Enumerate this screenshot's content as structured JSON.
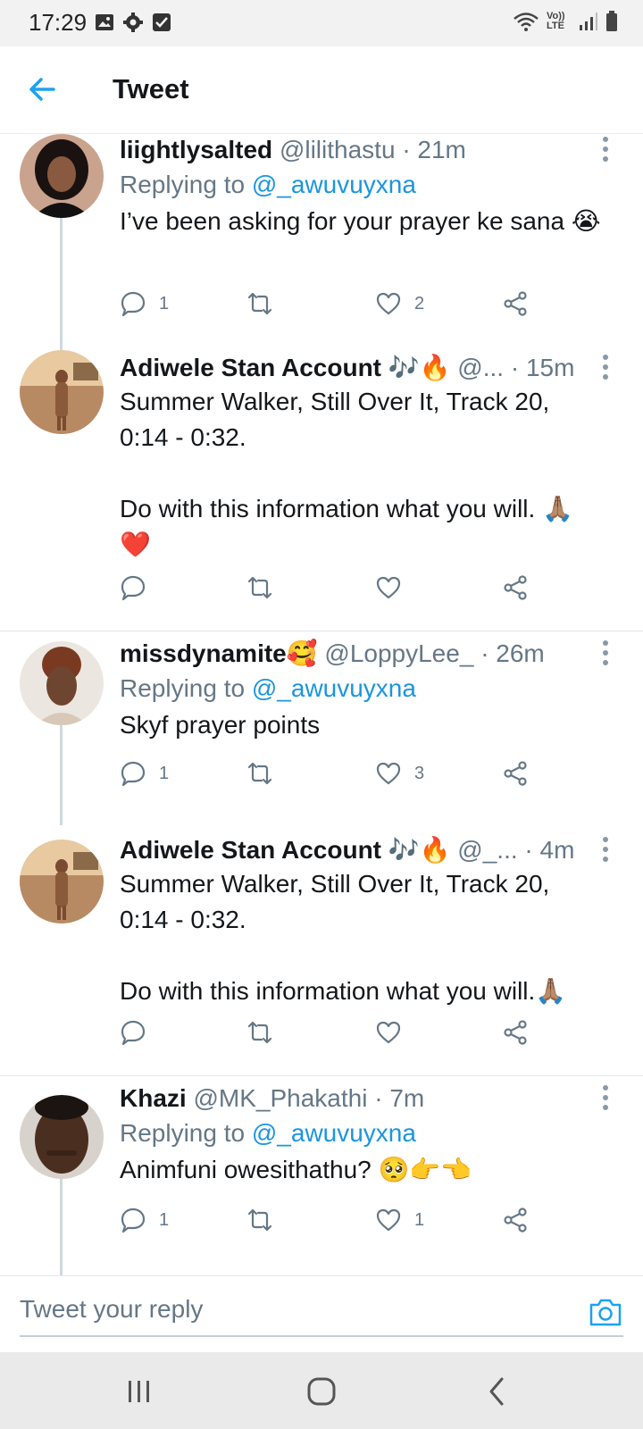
{
  "status_bar": {
    "time": "17:29",
    "left_icons": [
      "image-icon",
      "settings-icon",
      "checkbox-icon"
    ],
    "right_icons": [
      "wifi-icon",
      "volte-icon",
      "signal-icon",
      "battery-icon"
    ],
    "volte_label": "Vo)) LTE"
  },
  "header": {
    "title": "Tweet"
  },
  "tweets": [
    {
      "name": "liightlysalted",
      "handle": "@lilithastu",
      "time": "· 21m",
      "replying_prefix": "Replying to ",
      "replying_to": "@_awuvuyxna",
      "text": "I’ve been asking for your prayer ke sana 😭",
      "counts": {
        "reply": "1",
        "retweet": "",
        "like": "2"
      }
    },
    {
      "name": "Adiwele Stan Account 🎶🔥",
      "handle": "@...",
      "time": "· 15m",
      "text": "Summer Walker, Still Over It, Track 20,\n0:14 - 0:32.\n\nDo with this information what you will. 🙏🏽\n❤️",
      "counts": {
        "reply": "",
        "retweet": "",
        "like": ""
      }
    },
    {
      "name": "missdynamite🥰",
      "handle": "@LoppyLee_",
      "time": "· 26m",
      "replying_prefix": "Replying to ",
      "replying_to": "@_awuvuyxna",
      "text": "Skyf prayer points",
      "counts": {
        "reply": "1",
        "retweet": "",
        "like": "3"
      }
    },
    {
      "name": "Adiwele Stan Account 🎶🔥",
      "handle": "@_...",
      "time": "· 4m",
      "text": "Summer Walker, Still Over It, Track 20,\n0:14 - 0:32.\n\nDo with this information what you will.🙏🏽",
      "counts": {
        "reply": "",
        "retweet": "",
        "like": ""
      }
    },
    {
      "name": "Khazi",
      "handle": "@MK_Phakathi",
      "time": "· 7m",
      "replying_prefix": "Replying to ",
      "replying_to": "@_awuvuyxna",
      "text": "Animfuni owesithathu? 🥺👉👈",
      "counts": {
        "reply": "1",
        "retweet": "",
        "like": "1"
      }
    }
  ],
  "reply_bar": {
    "placeholder": "Tweet your reply"
  },
  "colors": {
    "accent": "#1da1f2",
    "mention": "#1b95e0",
    "secondary_text": "#657786",
    "thread_line": "#cfd9de"
  }
}
